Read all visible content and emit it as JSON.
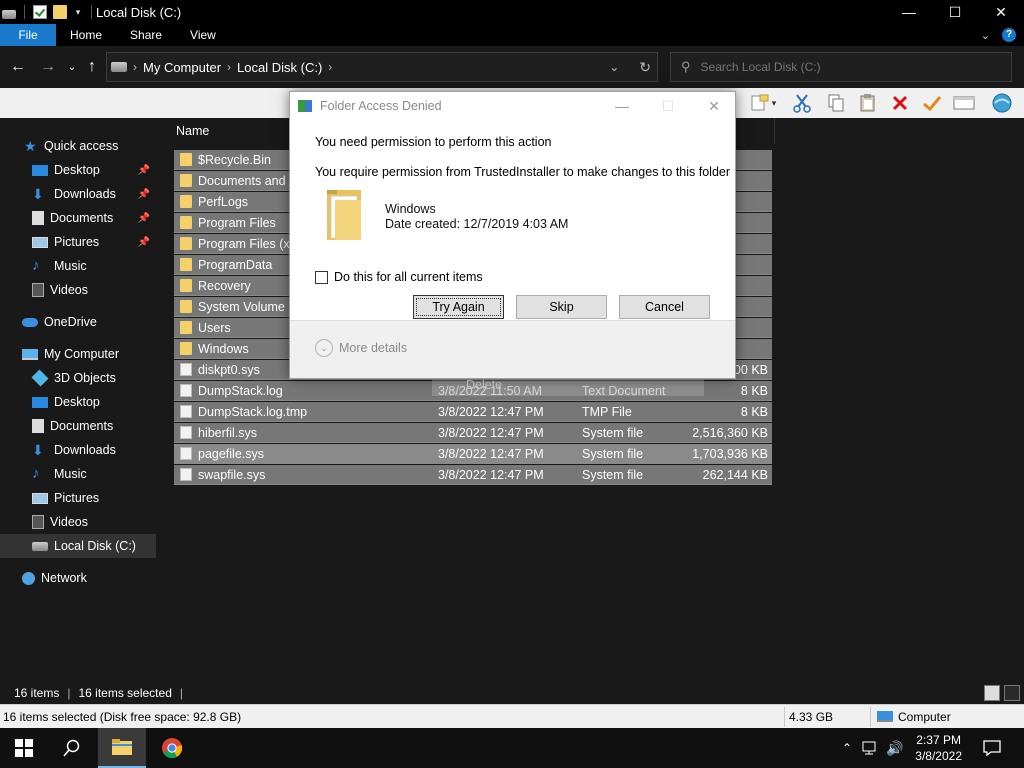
{
  "window": {
    "title": "Local Disk (C:)",
    "min": "—",
    "max": "☐",
    "close": "✕"
  },
  "ribbon": {
    "tabs": [
      "File",
      "Home",
      "Share",
      "View"
    ]
  },
  "address": {
    "crumbs": [
      "My Computer",
      "Local Disk (C:)"
    ],
    "search_placeholder": "Search Local Disk (C:)"
  },
  "nav_pane": {
    "quick_access": "Quick access",
    "quick_items": [
      "Desktop",
      "Downloads",
      "Documents",
      "Pictures",
      "Music",
      "Videos"
    ],
    "onedrive": "OneDrive",
    "my_computer": "My Computer",
    "computer_items": [
      "3D Objects",
      "Desktop",
      "Documents",
      "Downloads",
      "Music",
      "Pictures",
      "Videos",
      "Local Disk (C:)"
    ],
    "network": "Network"
  },
  "file_list": {
    "column_name": "Name",
    "rows": [
      {
        "name": "$Recycle.Bin",
        "date": "",
        "type": "",
        "size": "",
        "kind": "folder"
      },
      {
        "name": "Documents and Settings",
        "date": "",
        "type": "",
        "size": "",
        "kind": "folder"
      },
      {
        "name": "PerfLogs",
        "date": "",
        "type": "",
        "size": "",
        "kind": "folder"
      },
      {
        "name": "Program Files",
        "date": "",
        "type": "",
        "size": "",
        "kind": "folder"
      },
      {
        "name": "Program Files (x86)",
        "date": "",
        "type": "",
        "size": "",
        "kind": "folder"
      },
      {
        "name": "ProgramData",
        "date": "",
        "type": "",
        "size": "",
        "kind": "folder"
      },
      {
        "name": "Recovery",
        "date": "",
        "type": "",
        "size": "",
        "kind": "folder"
      },
      {
        "name": "System Volume Information",
        "date": "",
        "type": "",
        "size": "",
        "kind": "folder"
      },
      {
        "name": "Users",
        "date": "",
        "type": "",
        "size": "",
        "kind": "folder"
      },
      {
        "name": "Windows",
        "date": "",
        "type": "",
        "size": "",
        "kind": "folder"
      },
      {
        "name": "diskpt0.sys",
        "date": "",
        "type": "",
        "size": "000 KB",
        "kind": "file"
      },
      {
        "name": "DumpStack.log",
        "date": "3/8/2022 11:50 AM",
        "type": "Text Document",
        "size": "8 KB",
        "kind": "file"
      },
      {
        "name": "DumpStack.log.tmp",
        "date": "3/8/2022 12:47 PM",
        "type": "TMP File",
        "size": "8 KB",
        "kind": "file"
      },
      {
        "name": "hiberfil.sys",
        "date": "3/8/2022 12:47 PM",
        "type": "System file",
        "size": "2,516,360 KB",
        "kind": "file"
      },
      {
        "name": "pagefile.sys",
        "date": "3/8/2022 12:47 PM",
        "type": "System file",
        "size": "1,703,936 KB",
        "kind": "file"
      },
      {
        "name": "swapfile.sys",
        "date": "3/8/2022 12:47 PM",
        "type": "System file",
        "size": "262,144 KB",
        "kind": "file"
      }
    ],
    "drag_label": "Delete"
  },
  "dialog": {
    "title": "Folder Access Denied",
    "line1": "You need permission to perform this action",
    "line2": "You require permission from TrustedInstaller to make changes to this folder",
    "item_name": "Windows",
    "item_date": "Date created: 12/7/2019 4:03 AM",
    "checkbox_label": "Do this for all current items",
    "try_again": "Try Again",
    "skip": "Skip",
    "cancel": "Cancel",
    "more_details": "More details"
  },
  "status": {
    "item_count": "16 items",
    "selected": "16 items selected"
  },
  "classic_status": {
    "summary": "16 items selected (Disk free space: 92.8 GB)",
    "size": "4.33 GB",
    "location": "Computer"
  },
  "taskbar": {
    "time": "2:37 PM",
    "date": "3/8/2022"
  }
}
